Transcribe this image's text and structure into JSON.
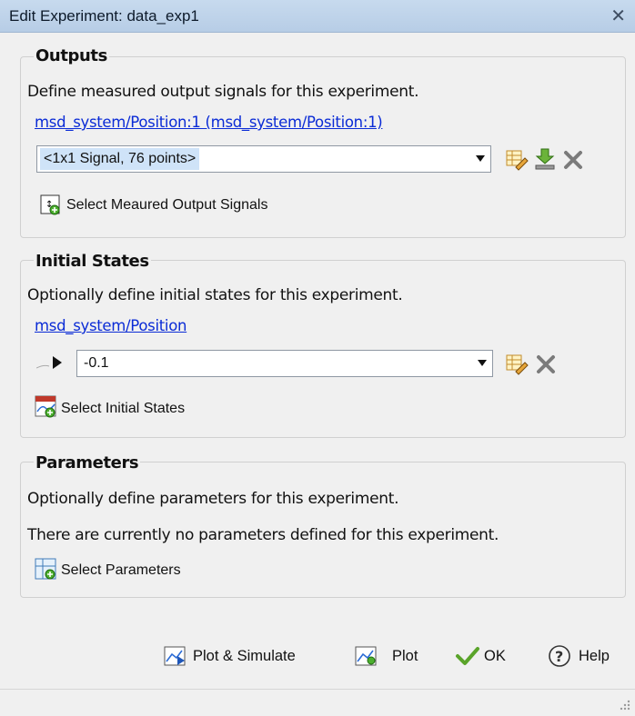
{
  "window": {
    "title": "Edit Experiment: data_exp1",
    "close_symbol": "✕"
  },
  "outputs": {
    "title": "Outputs",
    "description": "Define measured output signals for this experiment.",
    "signal_link": "msd_system/Position:1 (msd_system/Position:1)",
    "combo_value": "<1x1 Signal, 76 points>",
    "select_button": "Select Meaured Output Signals",
    "icons": [
      "edit-icon",
      "import-icon",
      "delete-icon",
      "select-signals-icon"
    ]
  },
  "initial_states": {
    "title": "Initial States",
    "description": "Optionally define initial states for this experiment.",
    "state_link": "msd_system/Position",
    "combo_value": "-0.1",
    "select_button": "Select Initial States",
    "icons": [
      "expand-arrow-icon",
      "edit-icon",
      "delete-icon",
      "select-states-icon"
    ]
  },
  "parameters": {
    "title": "Parameters",
    "description": "Optionally define parameters for this experiment.",
    "empty_message": "There are currently no parameters defined for this experiment.",
    "select_button": "Select Parameters",
    "icons": [
      "select-parameters-icon"
    ]
  },
  "footer": {
    "plot_simulate": "Plot & Simulate",
    "plot": "Plot",
    "ok": "OK",
    "help": "Help",
    "icons": [
      "plot-simulate-icon",
      "plot-icon",
      "checkmark-icon",
      "help-icon",
      "resize-grip-icon"
    ]
  },
  "colors": {
    "link": "#0a2bd6",
    "titlebar": "#c7daee",
    "selection": "#cfe3f8"
  }
}
